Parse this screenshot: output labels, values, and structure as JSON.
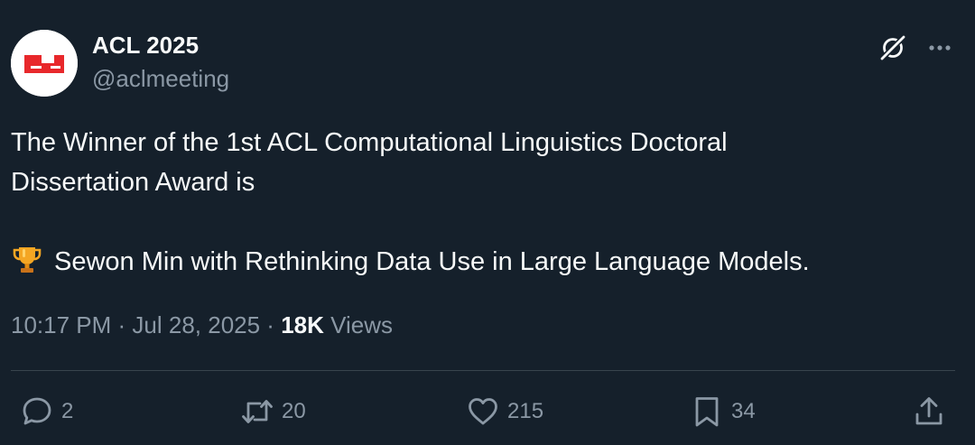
{
  "author": {
    "name": "ACL 2025",
    "handle": "@aclmeeting",
    "avatar_icon": "acl-logo",
    "avatar_color": "#e8282b"
  },
  "header_icons": {
    "grok": "grok-icon",
    "more": "more-icon"
  },
  "tweet": {
    "line1": "The Winner of the 1st ACL Computational Linguistics Doctoral",
    "line2": "Dissertation Award is",
    "line3": "Sewon Min  with Rethinking Data Use in Large Language Models.",
    "emoji_icon": "trophy-icon"
  },
  "meta": {
    "time": "10:17 PM",
    "sep1": " · ",
    "date": "Jul 28, 2025",
    "sep2": " · ",
    "views_count": "18K",
    "views_label": " Views"
  },
  "actions": {
    "replies": "2",
    "reposts": "20",
    "likes": "215",
    "bookmarks": "34"
  },
  "colors": {
    "background": "#15202b",
    "text": "#f7f9f9",
    "secondary": "#8b98a5",
    "divider": "#38444d"
  }
}
